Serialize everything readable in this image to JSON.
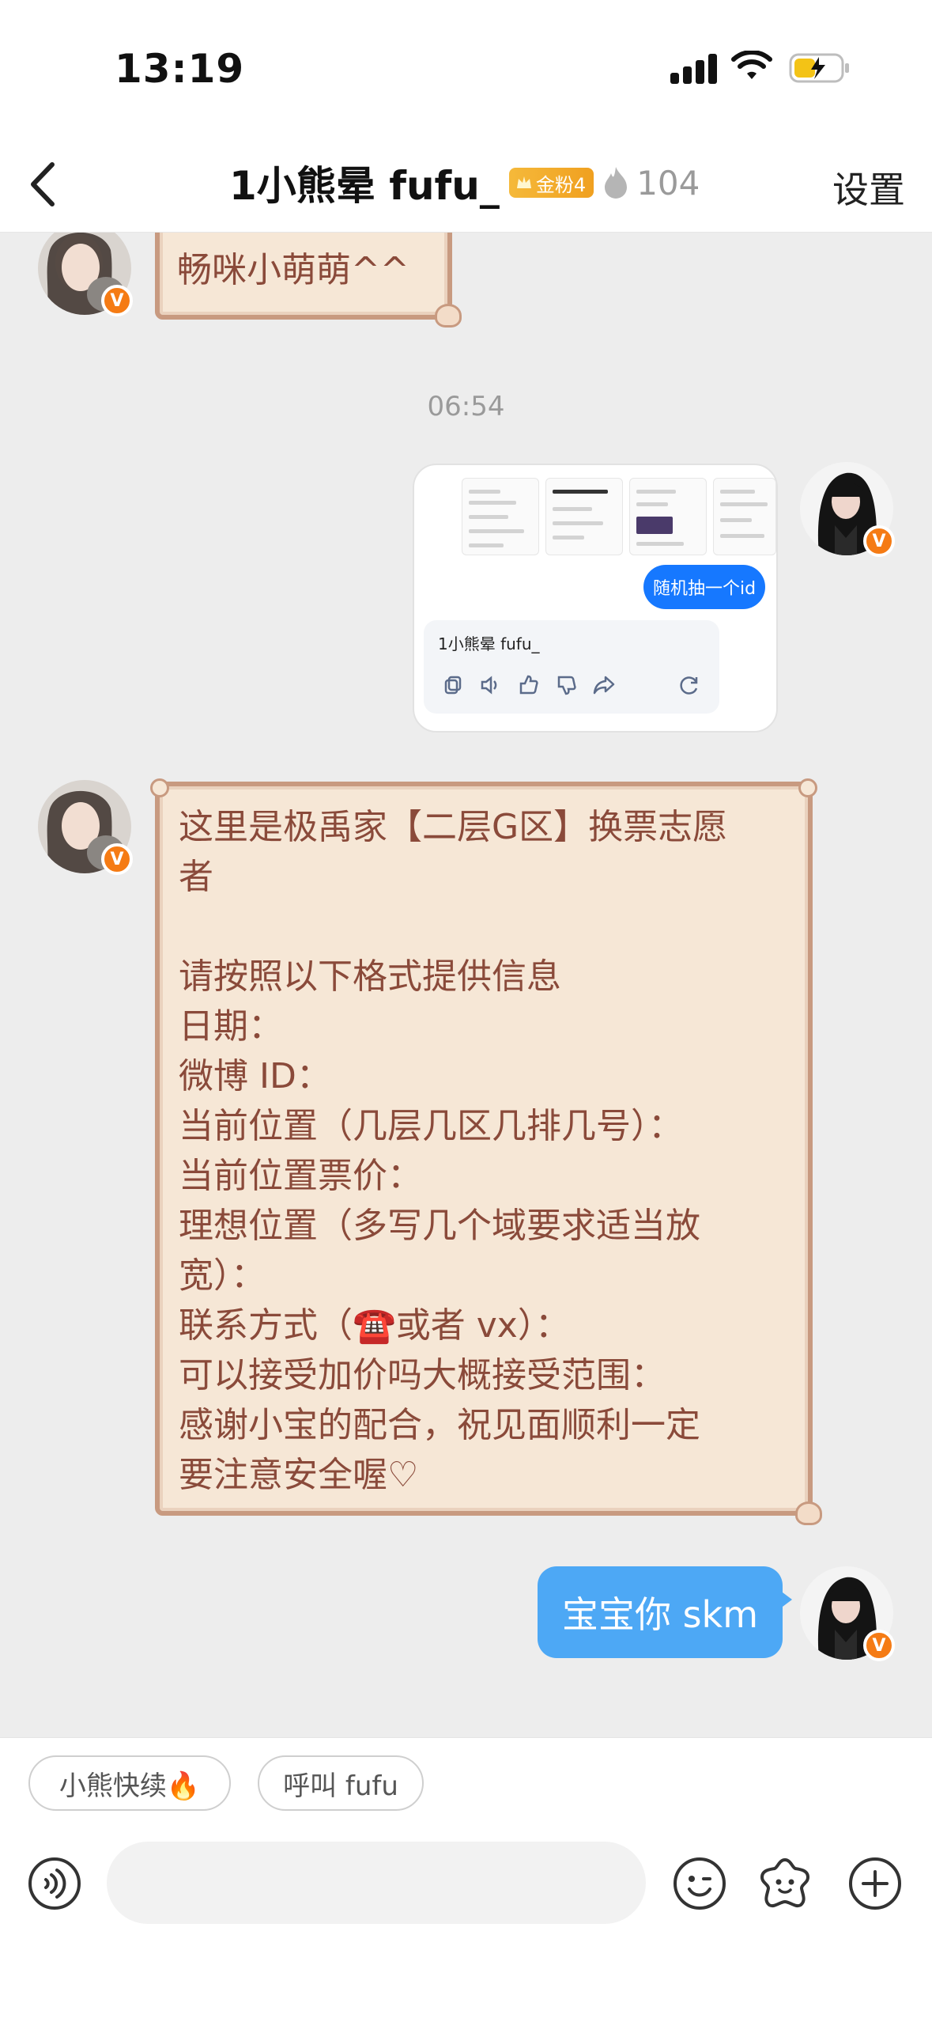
{
  "status_bar": {
    "time": "13:19"
  },
  "header": {
    "title": "1小熊晕 fufu_",
    "fan_badge": "金粉4",
    "heat_count": "104",
    "settings_label": "设置"
  },
  "messages": {
    "first_partial": {
      "text": "畅咪小萌萌^^"
    },
    "timestamp": "06:54",
    "shared_card": {
      "pill_label": "随机抽一个id",
      "reply_name": "1小熊晕 fufu_"
    },
    "long_message": {
      "text": "这里是极禹家【二层G区】换票志愿\n者\n\n请按照以下格式提供信息\n日期：\n微博 ID：\n当前位置（几层几区几排几号）：\n当前位置票价：\n理想位置（多写几个域要求适当放\n宽）：\n联系方式（☎️或者 vx）：\n可以接受加价吗大概接受范围：\n感谢小宝的配合，祝见面顺利一定\n要注意安全喔♡"
    },
    "reply": {
      "text": "宝宝你 skm"
    }
  },
  "quick_replies": [
    "小熊快续🔥",
    "呼叫 fufu"
  ],
  "input": {
    "placeholder": ""
  },
  "colors": {
    "accent_blue": "#4da8f5",
    "scroll_bg": "#f6e7d6",
    "scroll_text": "#8a4a3a",
    "badge_orange": "#f57b14"
  },
  "icons": [
    "back-icon",
    "flame-icon",
    "voice-icon",
    "emoji-icon",
    "sticker-icon",
    "plus-icon",
    "v-badge-icon"
  ]
}
